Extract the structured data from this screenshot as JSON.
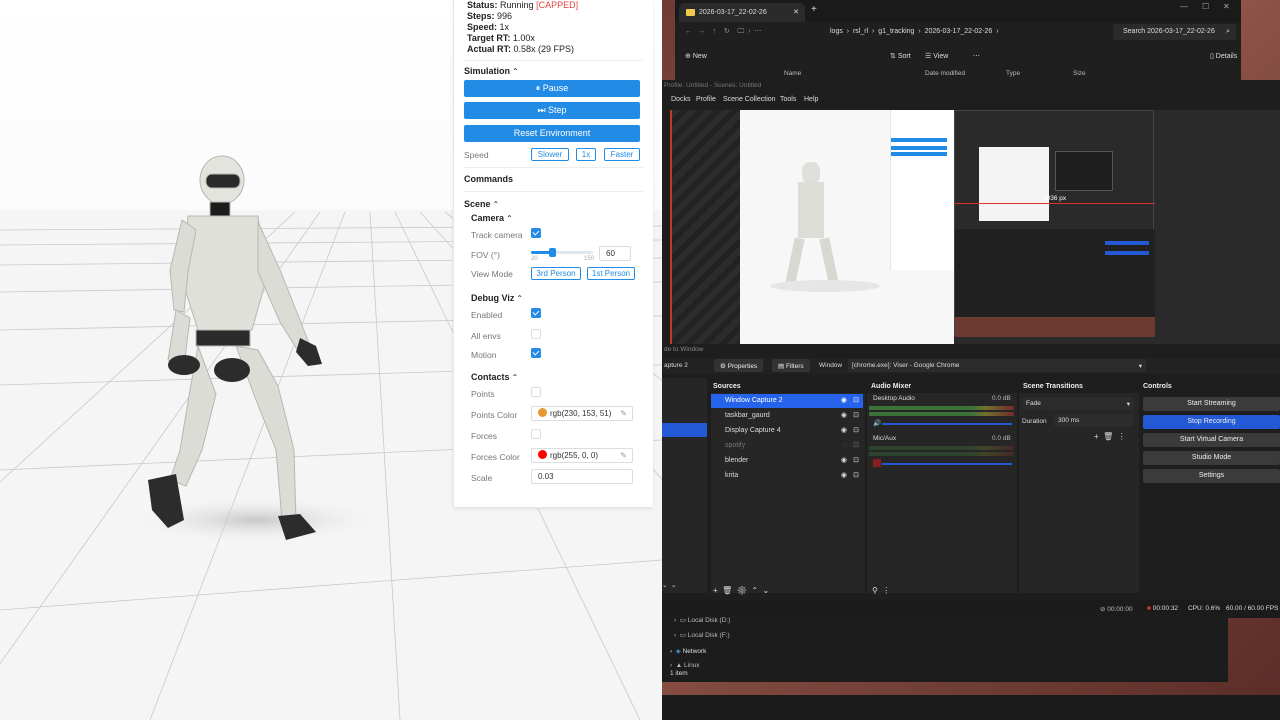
{
  "stats": {
    "status_label": "Status:",
    "status_value": "Running",
    "status_flag": "[CAPPED]",
    "steps_label": "Steps:",
    "steps_value": "996",
    "speed_label": "Speed:",
    "speed_value": "1x",
    "target_label": "Target RT:",
    "target_value": "1.00x",
    "actual_label": "Actual RT:",
    "actual_value": "0.58x (29 FPS)"
  },
  "simulation": {
    "title": "Simulation",
    "pause": "⏸ Pause",
    "step": "⏭ Step",
    "reset": "Reset Environment",
    "speed_label": "Speed",
    "slower": "Slower",
    "one_x": "1x",
    "faster": "Faster"
  },
  "commands": {
    "title": "Commands"
  },
  "scene": {
    "title": "Scene",
    "camera": {
      "title": "Camera",
      "track_label": "Track camera",
      "track": true,
      "fov_label": "FOV (°)",
      "fov_value": "60",
      "fov_min": "20",
      "fov_max": "150",
      "view_label": "View Mode",
      "third": "3rd Person",
      "first": "1st Person"
    },
    "debug": {
      "title": "Debug Viz",
      "enabled_label": "Enabled",
      "enabled": true,
      "allenvs_label": "All envs",
      "allenvs": false,
      "motion_label": "Motion",
      "motion": true
    },
    "contacts": {
      "title": "Contacts",
      "points_label": "Points",
      "points": false,
      "points_color_label": "Points Color",
      "points_color_value": "rgb(230, 153, 51)",
      "points_color": "#e69933",
      "forces_label": "Forces",
      "forces": false,
      "forces_color_label": "Forces Color",
      "forces_color_value": "rgb(255, 0, 0)",
      "forces_color": "#ff0000",
      "scale_label": "Scale",
      "scale_value": "0.03"
    }
  },
  "explorer": {
    "tab_title": "2026-03-17_22-02-26",
    "breadcrumb": [
      "logs",
      "rsl_rl",
      "g1_tracking",
      "2026-03-17_22-02-26"
    ],
    "search_placeholder": "Search 2026-03-17_22-02-26",
    "new": "New",
    "sort": "Sort",
    "view": "View",
    "details": "Details",
    "columns": [
      "Name",
      "Date modified",
      "Type",
      "Size"
    ],
    "nav": [
      "Local Disk (D:)",
      "Local Disk (F:)",
      "Network",
      "Linux"
    ],
    "status": "1 item"
  },
  "obs": {
    "title": "Profile: Untitled - Scenes: Untitled",
    "menu": [
      "Docks",
      "Profile",
      "Scene Collection",
      "Tools",
      "Help"
    ],
    "properties": "Properties",
    "filters": "Filters",
    "window_label": "Window",
    "window_value": "[chrome.exe]: Viser - Google Chrome",
    "scene_name": "apture 2",
    "sources_title": "Sources",
    "sources": [
      "Window Capture 2",
      "taskbar_gaurd",
      "Display Capture 4",
      "spotify",
      "blender",
      "krita"
    ],
    "mixer_title": "Audio Mixer",
    "desktop_audio": "Desktop Audio",
    "desktop_db": "0.0 dB",
    "mic": "Mic/Aux",
    "mic_db": "0.0 dB",
    "transitions_title": "Scene Transitions",
    "fade": "Fade",
    "duration_label": "Duration",
    "duration_value": "300 ms",
    "controls_title": "Controls",
    "controls": [
      "Start Streaming",
      "Stop Recording",
      "Start Virtual Camera",
      "Studio Mode",
      "Settings"
    ],
    "status_stream": "00:00:00",
    "status_rec": "00:00:32",
    "status_cpu": "CPU: 0.6%",
    "status_fps": "60.00 / 60.00 FPS",
    "preview_px": "1036 px"
  }
}
